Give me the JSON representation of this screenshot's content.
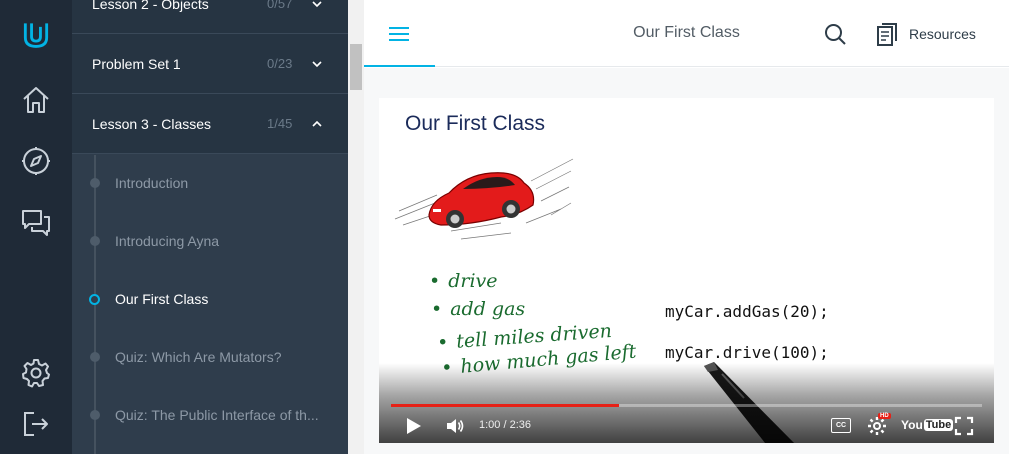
{
  "nav": {
    "lessons": [
      {
        "title": "Lesson 2 - Objects",
        "count": "0/57",
        "expanded": false
      },
      {
        "title": "Problem Set 1",
        "count": "0/23",
        "expanded": false
      },
      {
        "title": "Lesson 3 - Classes",
        "count": "1/45",
        "expanded": true
      }
    ],
    "concepts": [
      {
        "title": "Introduction",
        "active": false
      },
      {
        "title": "Introducing Ayna",
        "active": false
      },
      {
        "title": "Our First Class",
        "active": true
      },
      {
        "title": "Quiz: Which Are Mutators?",
        "active": false
      },
      {
        "title": "Quiz: The Public Interface of th...",
        "active": false
      }
    ]
  },
  "rail": {
    "icons": [
      "udacity-logo-icon",
      "home-icon",
      "compass-icon",
      "chat-icon",
      "gear-icon",
      "logout-icon"
    ]
  },
  "header": {
    "title": "Our First Class",
    "resources_label": "Resources"
  },
  "video": {
    "slide_title": "Our First Class",
    "handwritten_bullets": [
      "drive",
      "add gas",
      "tell miles driven",
      "how much gas left"
    ],
    "code_lines": [
      "myCar.addGas(20);",
      "myCar.drive(100);"
    ],
    "current_time": "1:00",
    "duration": "2:36",
    "played_fraction": 0.385,
    "loaded_fraction": 0.385,
    "youtube_logo": {
      "you": "You",
      "tube": "Tube"
    },
    "hd_label": "HD",
    "cc_label": "CC"
  },
  "colors": {
    "rail_bg": "#1f2a37",
    "nav_bg": "#2f3d4c",
    "accent": "#02b3e4",
    "progress_red": "#e62117"
  }
}
